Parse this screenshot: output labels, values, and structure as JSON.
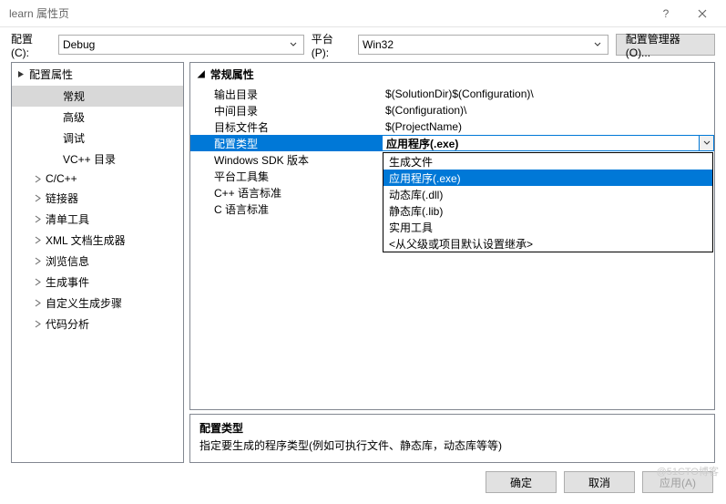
{
  "window": {
    "title": "learn 属性页"
  },
  "toolbar": {
    "config_label": "配置(C):",
    "config_value": "Debug",
    "platform_label": "平台(P):",
    "platform_value": "Win32",
    "manager_btn": "配置管理器(O)..."
  },
  "tree": {
    "root": "配置属性",
    "items": [
      {
        "label": "常规",
        "selected": true
      },
      {
        "label": "高级"
      },
      {
        "label": "调试"
      },
      {
        "label": "VC++ 目录"
      },
      {
        "label": "C/C++",
        "expandable": true
      },
      {
        "label": "链接器",
        "expandable": true
      },
      {
        "label": "清单工具",
        "expandable": true
      },
      {
        "label": "XML 文档生成器",
        "expandable": true
      },
      {
        "label": "浏览信息",
        "expandable": true
      },
      {
        "label": "生成事件",
        "expandable": true
      },
      {
        "label": "自定义生成步骤",
        "expandable": true
      },
      {
        "label": "代码分析",
        "expandable": true
      }
    ]
  },
  "props": {
    "group": "常规属性",
    "rows": [
      {
        "name": "输出目录",
        "value": "$(SolutionDir)$(Configuration)\\"
      },
      {
        "name": "中间目录",
        "value": "$(Configuration)\\"
      },
      {
        "name": "目标文件名",
        "value": "$(ProjectName)"
      },
      {
        "name": "配置类型",
        "value": "应用程序(.exe)",
        "selected": true
      },
      {
        "name": "Windows SDK 版本",
        "value": ""
      },
      {
        "name": "平台工具集",
        "value": ""
      },
      {
        "name": "C++ 语言标准",
        "value": ""
      },
      {
        "name": "C 语言标准",
        "value": ""
      }
    ],
    "dropdown": [
      {
        "label": "生成文件"
      },
      {
        "label": "应用程序(.exe)",
        "selected": true
      },
      {
        "label": "动态库(.dll)"
      },
      {
        "label": "静态库(.lib)"
      },
      {
        "label": "实用工具"
      },
      {
        "label": "<从父级或项目默认设置继承>"
      }
    ]
  },
  "desc": {
    "title": "配置类型",
    "text": "指定要生成的程序类型(例如可执行文件、静态库，动态库等等)"
  },
  "footer": {
    "ok": "确定",
    "cancel": "取消",
    "apply": "应用(A)"
  },
  "watermark": "@51CTO博客"
}
